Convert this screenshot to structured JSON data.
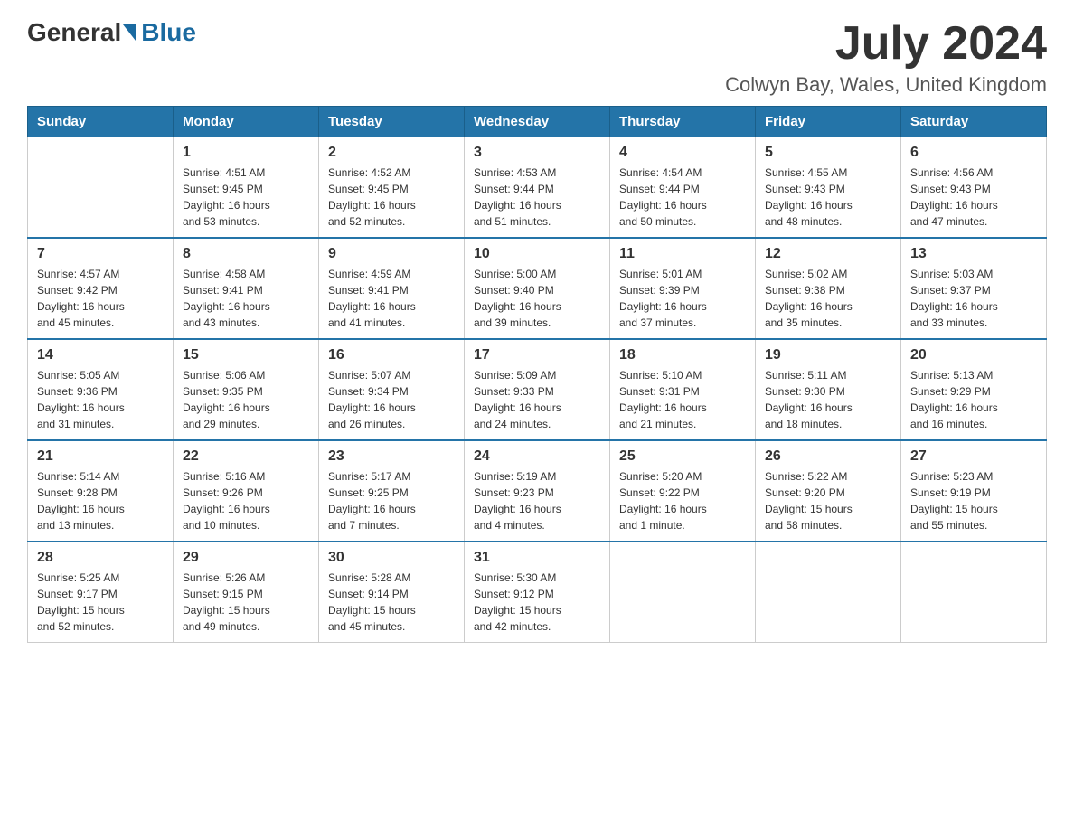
{
  "header": {
    "logo": {
      "general": "General",
      "blue": "Blue"
    },
    "title": "July 2024",
    "location": "Colwyn Bay, Wales, United Kingdom"
  },
  "weekdays": [
    "Sunday",
    "Monday",
    "Tuesday",
    "Wednesday",
    "Thursday",
    "Friday",
    "Saturday"
  ],
  "weeks": [
    [
      {
        "day": "",
        "info": ""
      },
      {
        "day": "1",
        "info": "Sunrise: 4:51 AM\nSunset: 9:45 PM\nDaylight: 16 hours\nand 53 minutes."
      },
      {
        "day": "2",
        "info": "Sunrise: 4:52 AM\nSunset: 9:45 PM\nDaylight: 16 hours\nand 52 minutes."
      },
      {
        "day": "3",
        "info": "Sunrise: 4:53 AM\nSunset: 9:44 PM\nDaylight: 16 hours\nand 51 minutes."
      },
      {
        "day": "4",
        "info": "Sunrise: 4:54 AM\nSunset: 9:44 PM\nDaylight: 16 hours\nand 50 minutes."
      },
      {
        "day": "5",
        "info": "Sunrise: 4:55 AM\nSunset: 9:43 PM\nDaylight: 16 hours\nand 48 minutes."
      },
      {
        "day": "6",
        "info": "Sunrise: 4:56 AM\nSunset: 9:43 PM\nDaylight: 16 hours\nand 47 minutes."
      }
    ],
    [
      {
        "day": "7",
        "info": "Sunrise: 4:57 AM\nSunset: 9:42 PM\nDaylight: 16 hours\nand 45 minutes."
      },
      {
        "day": "8",
        "info": "Sunrise: 4:58 AM\nSunset: 9:41 PM\nDaylight: 16 hours\nand 43 minutes."
      },
      {
        "day": "9",
        "info": "Sunrise: 4:59 AM\nSunset: 9:41 PM\nDaylight: 16 hours\nand 41 minutes."
      },
      {
        "day": "10",
        "info": "Sunrise: 5:00 AM\nSunset: 9:40 PM\nDaylight: 16 hours\nand 39 minutes."
      },
      {
        "day": "11",
        "info": "Sunrise: 5:01 AM\nSunset: 9:39 PM\nDaylight: 16 hours\nand 37 minutes."
      },
      {
        "day": "12",
        "info": "Sunrise: 5:02 AM\nSunset: 9:38 PM\nDaylight: 16 hours\nand 35 minutes."
      },
      {
        "day": "13",
        "info": "Sunrise: 5:03 AM\nSunset: 9:37 PM\nDaylight: 16 hours\nand 33 minutes."
      }
    ],
    [
      {
        "day": "14",
        "info": "Sunrise: 5:05 AM\nSunset: 9:36 PM\nDaylight: 16 hours\nand 31 minutes."
      },
      {
        "day": "15",
        "info": "Sunrise: 5:06 AM\nSunset: 9:35 PM\nDaylight: 16 hours\nand 29 minutes."
      },
      {
        "day": "16",
        "info": "Sunrise: 5:07 AM\nSunset: 9:34 PM\nDaylight: 16 hours\nand 26 minutes."
      },
      {
        "day": "17",
        "info": "Sunrise: 5:09 AM\nSunset: 9:33 PM\nDaylight: 16 hours\nand 24 minutes."
      },
      {
        "day": "18",
        "info": "Sunrise: 5:10 AM\nSunset: 9:31 PM\nDaylight: 16 hours\nand 21 minutes."
      },
      {
        "day": "19",
        "info": "Sunrise: 5:11 AM\nSunset: 9:30 PM\nDaylight: 16 hours\nand 18 minutes."
      },
      {
        "day": "20",
        "info": "Sunrise: 5:13 AM\nSunset: 9:29 PM\nDaylight: 16 hours\nand 16 minutes."
      }
    ],
    [
      {
        "day": "21",
        "info": "Sunrise: 5:14 AM\nSunset: 9:28 PM\nDaylight: 16 hours\nand 13 minutes."
      },
      {
        "day": "22",
        "info": "Sunrise: 5:16 AM\nSunset: 9:26 PM\nDaylight: 16 hours\nand 10 minutes."
      },
      {
        "day": "23",
        "info": "Sunrise: 5:17 AM\nSunset: 9:25 PM\nDaylight: 16 hours\nand 7 minutes."
      },
      {
        "day": "24",
        "info": "Sunrise: 5:19 AM\nSunset: 9:23 PM\nDaylight: 16 hours\nand 4 minutes."
      },
      {
        "day": "25",
        "info": "Sunrise: 5:20 AM\nSunset: 9:22 PM\nDaylight: 16 hours\nand 1 minute."
      },
      {
        "day": "26",
        "info": "Sunrise: 5:22 AM\nSunset: 9:20 PM\nDaylight: 15 hours\nand 58 minutes."
      },
      {
        "day": "27",
        "info": "Sunrise: 5:23 AM\nSunset: 9:19 PM\nDaylight: 15 hours\nand 55 minutes."
      }
    ],
    [
      {
        "day": "28",
        "info": "Sunrise: 5:25 AM\nSunset: 9:17 PM\nDaylight: 15 hours\nand 52 minutes."
      },
      {
        "day": "29",
        "info": "Sunrise: 5:26 AM\nSunset: 9:15 PM\nDaylight: 15 hours\nand 49 minutes."
      },
      {
        "day": "30",
        "info": "Sunrise: 5:28 AM\nSunset: 9:14 PM\nDaylight: 15 hours\nand 45 minutes."
      },
      {
        "day": "31",
        "info": "Sunrise: 5:30 AM\nSunset: 9:12 PM\nDaylight: 15 hours\nand 42 minutes."
      },
      {
        "day": "",
        "info": ""
      },
      {
        "day": "",
        "info": ""
      },
      {
        "day": "",
        "info": ""
      }
    ]
  ]
}
